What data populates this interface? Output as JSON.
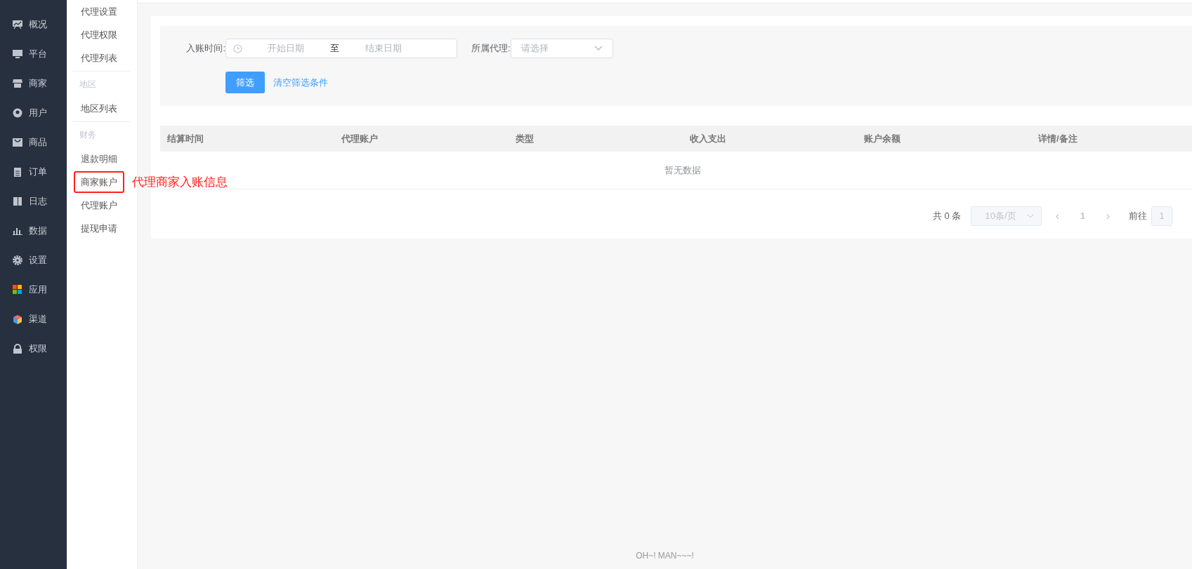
{
  "nav": [
    {
      "label": "概况"
    },
    {
      "label": "平台"
    },
    {
      "label": "商家"
    },
    {
      "label": "用户"
    },
    {
      "label": "商品"
    },
    {
      "label": "订单"
    },
    {
      "label": "日志"
    },
    {
      "label": "数据"
    },
    {
      "label": "设置"
    },
    {
      "label": "应用"
    },
    {
      "label": "渠道"
    },
    {
      "label": "权限"
    }
  ],
  "submenu": [
    {
      "kind": "item",
      "label": "代理设置",
      "outlined": false
    },
    {
      "kind": "item",
      "label": "代理权限",
      "outlined": false
    },
    {
      "kind": "item",
      "label": "代理列表",
      "outlined": false
    },
    {
      "kind": "heading",
      "label": "地区"
    },
    {
      "kind": "item",
      "label": "地区列表",
      "outlined": false
    },
    {
      "kind": "heading",
      "label": "财务"
    },
    {
      "kind": "item",
      "label": "退款明细",
      "outlined": false
    },
    {
      "kind": "item",
      "label": "商家账户",
      "outlined": true
    },
    {
      "kind": "item",
      "label": "代理账户",
      "outlined": false
    },
    {
      "kind": "item",
      "label": "提现申请",
      "outlined": false
    }
  ],
  "annotation": {
    "text": "代理商家入账信息"
  },
  "filters": {
    "date_label": "入账时间:",
    "start_placeholder": "开始日期",
    "separator": "至",
    "end_placeholder": "结束日期",
    "agent_label": "所属代理:",
    "agent_placeholder": "请选择",
    "filter_button": "筛选",
    "clear_link": "清空筛选条件"
  },
  "table": {
    "columns": [
      "结算时间",
      "代理账户",
      "类型",
      "收入支出",
      "账户余额",
      "详情/备注"
    ],
    "empty_text": "暂无数据"
  },
  "pagination": {
    "total": "共 0 条",
    "page_size": "10条/页",
    "prev": "‹",
    "current_page": "1",
    "next": "›",
    "goto_label": "前往",
    "goto_value": "1"
  },
  "footer": "OH~! MAN~~~!"
}
